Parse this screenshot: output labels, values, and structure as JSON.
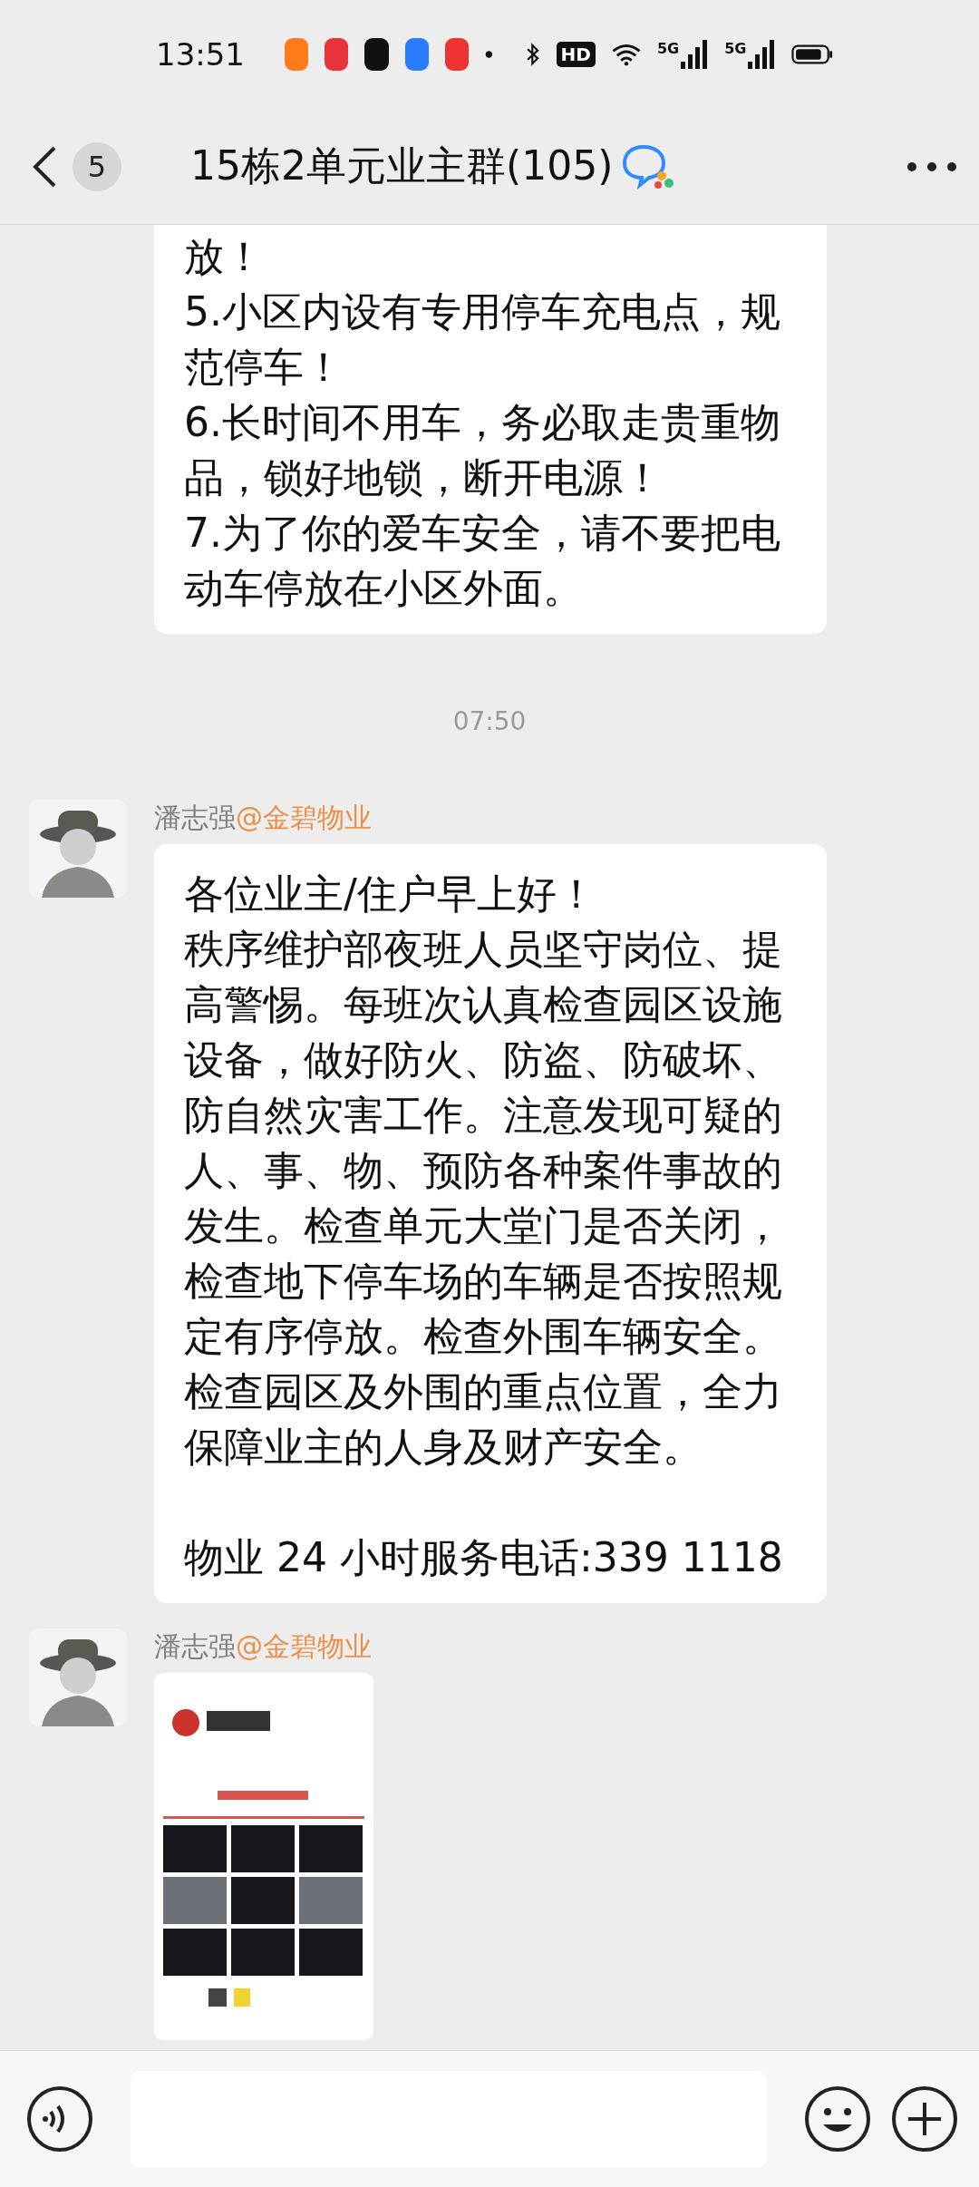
{
  "status_bar": {
    "time": "13:51",
    "hd": "HD",
    "networks": [
      "5G",
      "5G"
    ]
  },
  "header": {
    "unread": "5",
    "title": "15栋2单元业主群(105)"
  },
  "messages": [
    {
      "kind": "continuation",
      "paragraphs": [
        "放！",
        "5.小区内设有专用停车充电点，规范停车！",
        "6.长时间不用车，务必取走贵重物品，锁好地锁，断开电源！",
        "7.为了你的爱车安全，请不要把电动车停放在小区外面。"
      ]
    },
    {
      "kind": "time",
      "text": "07:50"
    },
    {
      "kind": "text",
      "sender": "潘志强",
      "mention": "@金碧物业",
      "paragraphs": [
        "各位业主/住户早上好！",
        "秩序维护部夜班人员坚守岗位、提高警惕。每班次认真检查园区设施设备，做好防火、防盗、防破坏、防自然灾害工作。注意发现可疑的人、事、物、预防各种案件事故的发生。检查单元大堂门是否关闭，检查地下停车场的车辆是否按照规定有序停放。检查外围车辆安全。检查园区及外围的重点位置，全力保障业主的人身及财产安全。"
      ],
      "footer": "物业 24 小时服务电话:339 1118"
    },
    {
      "sender": "潘志强",
      "mention": "@金碧物业"
    }
  ]
}
